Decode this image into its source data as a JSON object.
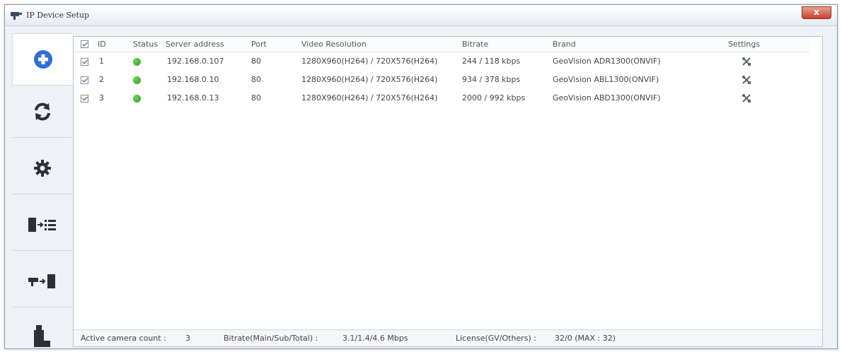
{
  "window": {
    "title": "IP Device Setup",
    "close_label": "x"
  },
  "sidebar": {
    "items": [
      {
        "name": "add",
        "icon": "plus-circle-icon"
      },
      {
        "name": "refresh",
        "icon": "refresh-icon"
      },
      {
        "name": "settings",
        "icon": "gear-icon"
      },
      {
        "name": "export-to-list",
        "icon": "device-to-list-icon"
      },
      {
        "name": "camera-to-device",
        "icon": "camera-to-device-icon"
      },
      {
        "name": "usb",
        "icon": "usb-drive-icon"
      }
    ]
  },
  "table": {
    "headers": {
      "id": "ID",
      "status": "Status",
      "server": "Server address",
      "port": "Port",
      "resolution": "Video Resolution",
      "bitrate": "Bitrate",
      "brand": "Brand",
      "settings": "Settings"
    },
    "rows": [
      {
        "id": "1",
        "status": "online",
        "server": "192.168.0.107",
        "port": "80",
        "resolution": "1280X960(H264) / 720X576(H264)",
        "bitrate": "244 / 118 kbps",
        "brand": "GeoVision ADR1300(ONVIF)"
      },
      {
        "id": "2",
        "status": "online",
        "server": "192.168.0.10",
        "port": "80",
        "resolution": "1280X960(H264) / 720X576(H264)",
        "bitrate": "934 / 378 kbps",
        "brand": "GeoVision ABL1300(ONVIF)"
      },
      {
        "id": "3",
        "status": "online",
        "server": "192.168.0.13",
        "port": "80",
        "resolution": "1280X960(H264) / 720X576(H264)",
        "bitrate": "2000 / 992 kbps",
        "brand": "GeoVision ABD1300(ONVIF)"
      }
    ]
  },
  "statusbar": {
    "active_label": "Active camera count :",
    "active_value": "3",
    "bitrate_label": "Bitrate(Main/Sub/Total) :",
    "bitrate_value": "3.1/1.4/4.6 Mbps",
    "license_label": "License(GV/Others) :",
    "license_value": "32/0 (MAX : 32)"
  },
  "colors": {
    "accent": "#2f6fd6",
    "status_online": "#3aa52c",
    "close": "#c7402a"
  }
}
